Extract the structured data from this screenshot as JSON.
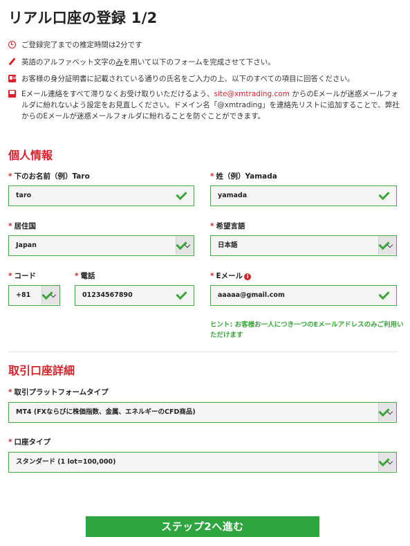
{
  "page": {
    "title": "リアル口座の登録 1/2"
  },
  "notices": [
    {
      "icon": "clock-icon",
      "text": "ご登録完了までの推定時間は2分です"
    },
    {
      "icon": "pen-icon",
      "text_before": "英語のアルファベット文字の",
      "text_underline": "み",
      "text_after": "を用いて以下のフォームを完成させて下さい。"
    },
    {
      "icon": "id-card-icon",
      "text": "お客様の身分証明書に記載されている通りの氏名をご入力の上、以下のすべての項目に回答ください。"
    },
    {
      "icon": "mail-icon",
      "text_before": "Eメール連絡をすべて滞りなくお受け取りいただけるよう、",
      "email": "site@xmtrading.com",
      "text_after": " からのEメールが迷惑メールフォルダに紛れないよう設定をお見直しください。ドメイン名「@xmtrading」を連絡先リストに追加することで、弊社からのEメールが迷惑メールフォルダに紛れることを防ぐことができます。"
    }
  ],
  "personal": {
    "section_title": "個人情報",
    "required_mark": "*",
    "first_name": {
      "label": "下のお名前（例）Taro",
      "value": "taro"
    },
    "last_name": {
      "label": "姓（例）Yamada",
      "value": "yamada"
    },
    "country": {
      "label": "居住国",
      "value": "Japan"
    },
    "language": {
      "label": "希望言語",
      "value": "日本語"
    },
    "code": {
      "label": "コード",
      "value": "+81"
    },
    "phone": {
      "label": "電話",
      "value": "01234567890"
    },
    "email": {
      "label": "Eメール",
      "info": "i",
      "value": "aaaaa@gmail.com"
    },
    "hint": "ヒント: お客様お一人につき一つのEメールアドレスのみご利用いただけます"
  },
  "account": {
    "section_title": "取引口座詳細",
    "platform": {
      "label": "取引プラットフォームタイプ",
      "value": "MT4 (FXならびに株価指数、金属、エネルギーのCFD商品)"
    },
    "account_type": {
      "label": "口座タイプ",
      "value": "スタンダード (1 lot=100,000)"
    }
  },
  "submit_label": "ステップ2へ進む",
  "colors": {
    "accent_red": "#d8232a",
    "success_green": "#3aa63a",
    "button_green": "#2fa53f"
  }
}
